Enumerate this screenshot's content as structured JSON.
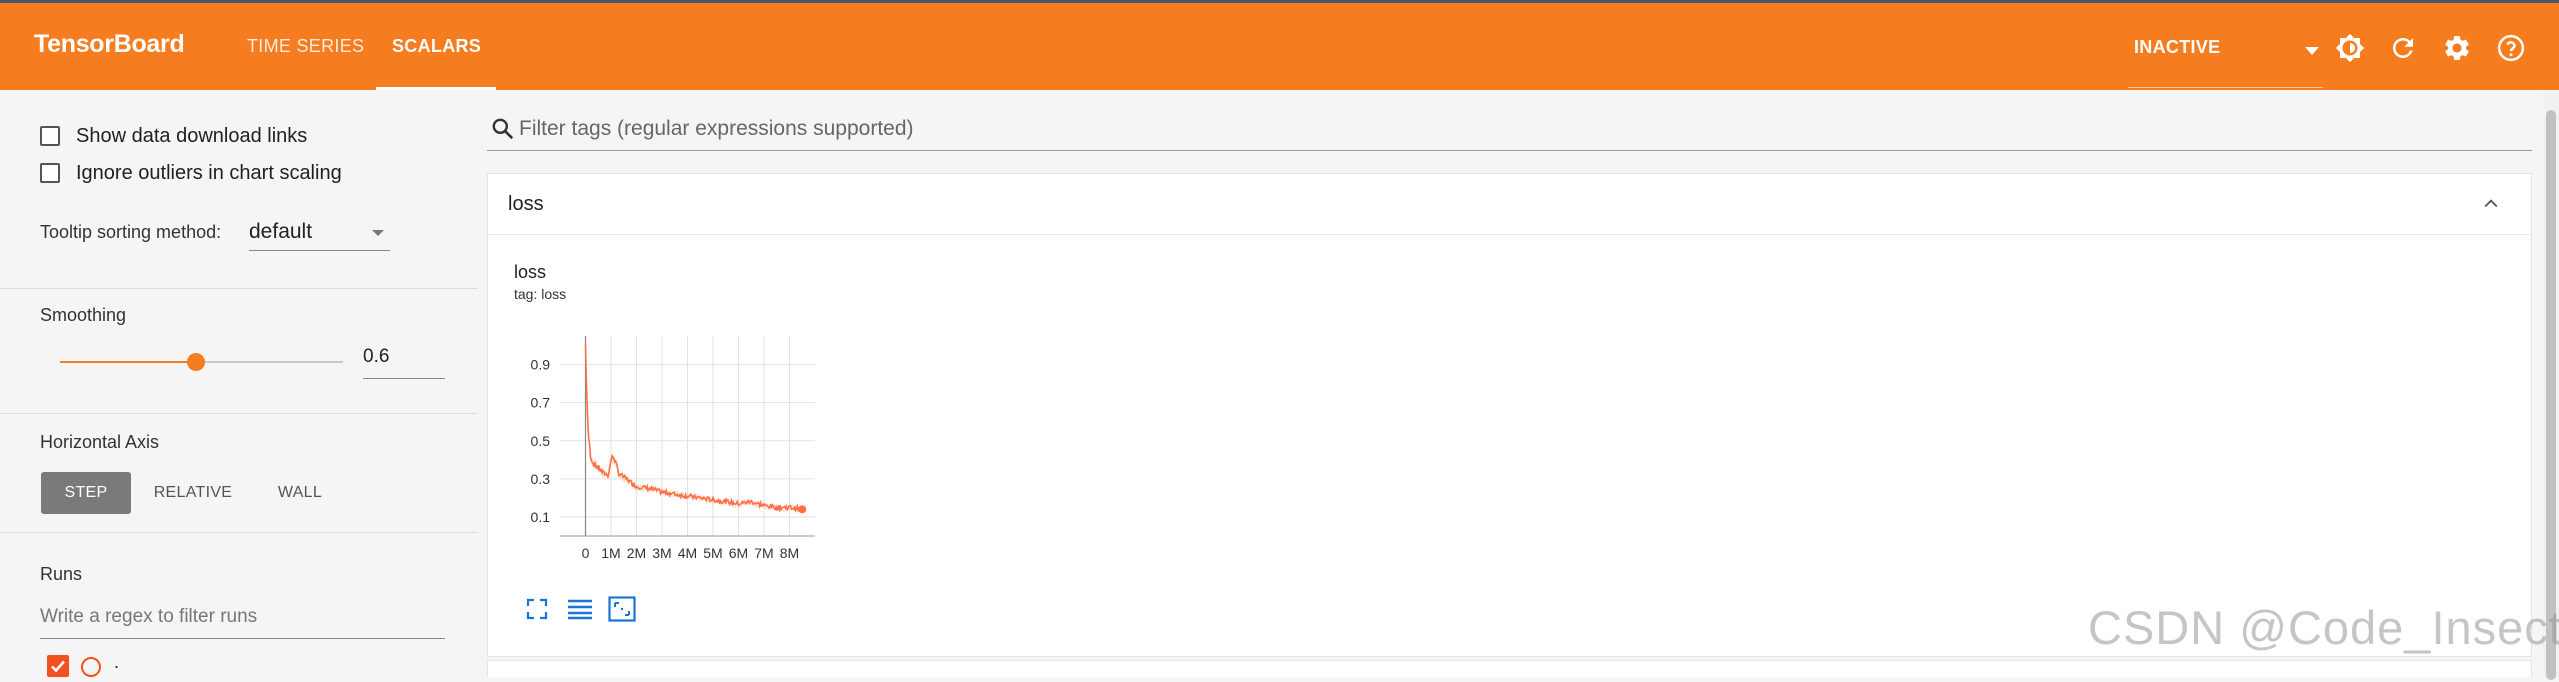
{
  "header": {
    "brand": "TensorBoard",
    "tabs": [
      {
        "label": "TIME SERIES"
      },
      {
        "label": "SCALARS",
        "active": true
      }
    ],
    "status_select": "INACTIVE",
    "icons": [
      "brightness-icon",
      "refresh-icon",
      "settings-icon",
      "help-icon"
    ],
    "bg_color": "#f57c1f"
  },
  "sidebar": {
    "show_download_links": {
      "label": "Show data download links",
      "checked": false
    },
    "ignore_outliers": {
      "label": "Ignore outliers in chart scaling",
      "checked": false
    },
    "tooltip_sorting": {
      "label": "Tooltip sorting method:",
      "value": "default"
    },
    "smoothing": {
      "label": "Smoothing",
      "value": "0.6",
      "fraction": 0.6
    },
    "horizontal_axis": {
      "label": "Horizontal Axis",
      "options": [
        "STEP",
        "RELATIVE",
        "WALL"
      ],
      "selected": "STEP"
    },
    "runs": {
      "label": "Runs",
      "filter_placeholder": "Write a regex to filter runs",
      "items": [
        {
          "name": ".",
          "checked": true,
          "color": "#f4511e"
        }
      ]
    }
  },
  "main": {
    "filter_placeholder": "Filter tags (regular expressions supported)",
    "group": {
      "title": "loss",
      "expanded": true
    },
    "card": {
      "title": "loss",
      "tag": "tag: loss"
    },
    "card_icons": [
      "fit-to-screen-icon",
      "toggle-log-scale-icon",
      "fit-domain-icon"
    ]
  },
  "chart_data": {
    "type": "line",
    "title": "loss",
    "subtitle": "tag: loss",
    "x_ticks": [
      "0",
      "1M",
      "2M",
      "3M",
      "4M",
      "5M",
      "6M",
      "7M",
      "8M"
    ],
    "y_ticks": [
      "0.1",
      "0.3",
      "0.5",
      "0.7",
      "0.9"
    ],
    "xlim": [
      -1000000,
      9000000
    ],
    "ylim": [
      0.0,
      1.05
    ],
    "grid": true,
    "series": [
      {
        "color": "#ff7043",
        "x": [
          0,
          50000,
          100000,
          200000,
          300000,
          500000,
          700000,
          900000,
          1000000,
          1100000,
          1300000,
          1600000,
          2000000,
          2500000,
          3000000,
          3500000,
          4000000,
          4500000,
          5000000,
          5500000,
          6000000,
          6500000,
          7000000,
          7500000,
          8000000,
          8500000
        ],
        "y": [
          1.0,
          0.75,
          0.55,
          0.42,
          0.38,
          0.36,
          0.33,
          0.32,
          0.4,
          0.42,
          0.33,
          0.3,
          0.26,
          0.25,
          0.23,
          0.22,
          0.21,
          0.2,
          0.19,
          0.18,
          0.17,
          0.18,
          0.16,
          0.15,
          0.15,
          0.14
        ]
      }
    ]
  },
  "watermark": "CSDN @Code_Insect"
}
